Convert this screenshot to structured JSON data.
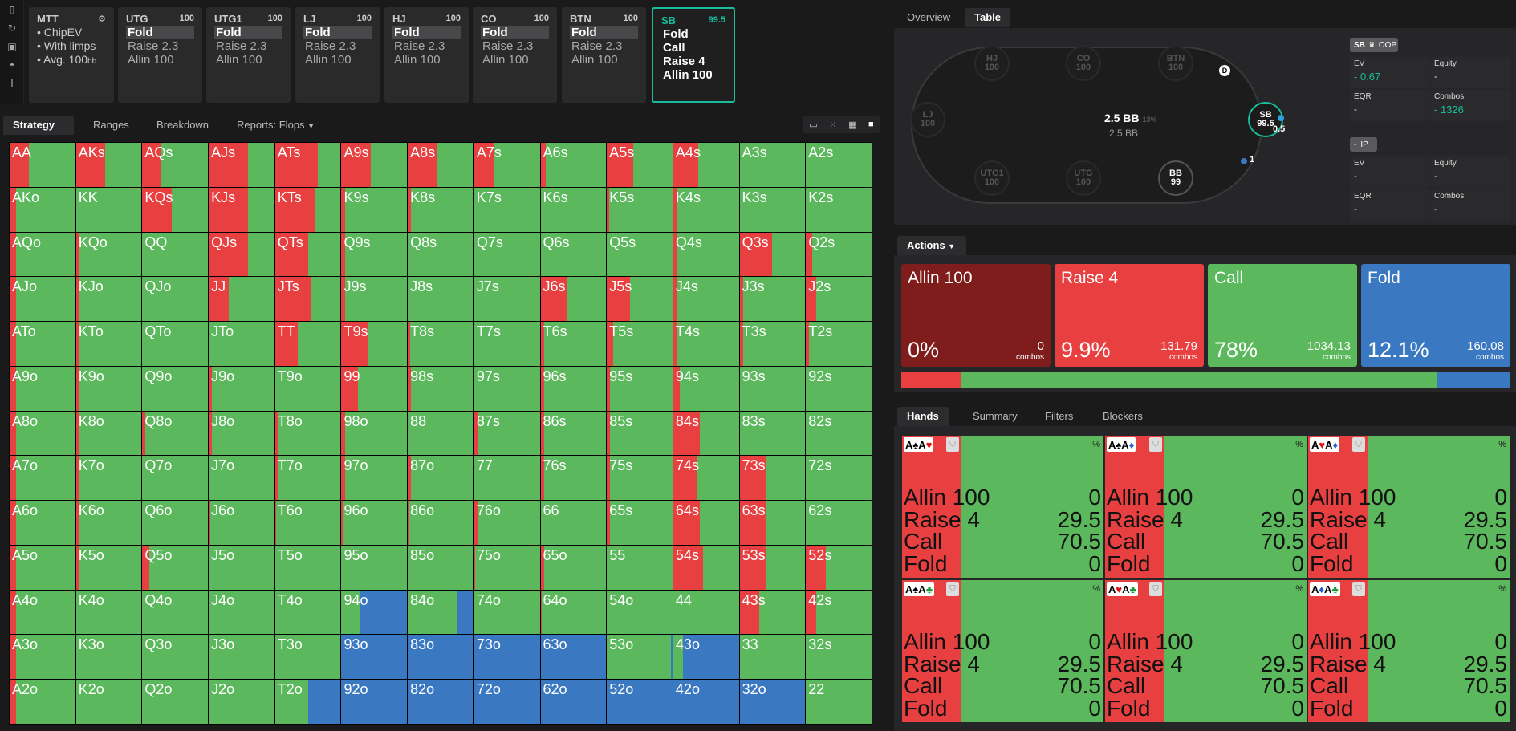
{
  "toolbar_icons": [
    "bookmark-icon",
    "refresh-icon",
    "save-icon",
    "gamepad-icon",
    "text-cursor-icon"
  ],
  "mtt": {
    "title": "MTT",
    "settings_icon": "gear-icon",
    "items": [
      "ChipEV",
      "With limps",
      "Avg. 100"
    ],
    "unit": "bb"
  },
  "positions": [
    {
      "name": "UTG",
      "stack": "100",
      "actions": [
        "Fold",
        "Raise 2.3",
        "Allin 100"
      ],
      "selected": 0
    },
    {
      "name": "UTG1",
      "stack": "100",
      "actions": [
        "Fold",
        "Raise 2.3",
        "Allin 100"
      ],
      "selected": 0
    },
    {
      "name": "LJ",
      "stack": "100",
      "actions": [
        "Fold",
        "Raise 2.3",
        "Allin 100"
      ],
      "selected": 0
    },
    {
      "name": "HJ",
      "stack": "100",
      "actions": [
        "Fold",
        "Raise 2.3",
        "Allin 100"
      ],
      "selected": 0
    },
    {
      "name": "CO",
      "stack": "100",
      "actions": [
        "Fold",
        "Raise 2.3",
        "Allin 100"
      ],
      "selected": 0
    },
    {
      "name": "BTN",
      "stack": "100",
      "actions": [
        "Fold",
        "Raise 2.3",
        "Allin 100"
      ],
      "selected": 0
    },
    {
      "name": "SB",
      "stack": "99.5",
      "actions": [
        "Fold",
        "Call",
        "Raise 4",
        "Allin 100"
      ],
      "selected": -1
    }
  ],
  "main_tabs": [
    "Strategy",
    "Ranges",
    "Breakdown",
    "Reports: Flops"
  ],
  "colors": {
    "raise": "#e84040",
    "call": "#5cb85c",
    "fold": "#3b78c2",
    "allin": "#7f1d1d",
    "accent": "#1abc9c"
  },
  "grid": [
    [
      "AA",
      "AKs",
      "AQs",
      "AJs",
      "ATs",
      "A9s",
      "A8s",
      "A7s",
      "A6s",
      "A5s",
      "A4s",
      "A3s",
      "A2s"
    ],
    [
      "AKo",
      "KK",
      "KQs",
      "KJs",
      "KTs",
      "K9s",
      "K8s",
      "K7s",
      "K6s",
      "K5s",
      "K4s",
      "K3s",
      "K2s"
    ],
    [
      "AQo",
      "KQo",
      "QQ",
      "QJs",
      "QTs",
      "Q9s",
      "Q8s",
      "Q7s",
      "Q6s",
      "Q5s",
      "Q4s",
      "Q3s",
      "Q2s"
    ],
    [
      "AJo",
      "KJo",
      "QJo",
      "JJ",
      "JTs",
      "J9s",
      "J8s",
      "J7s",
      "J6s",
      "J5s",
      "J4s",
      "J3s",
      "J2s"
    ],
    [
      "ATo",
      "KTo",
      "QTo",
      "JTo",
      "TT",
      "T9s",
      "T8s",
      "T7s",
      "T6s",
      "T5s",
      "T4s",
      "T3s",
      "T2s"
    ],
    [
      "A9o",
      "K9o",
      "Q9o",
      "J9o",
      "T9o",
      "99",
      "98s",
      "97s",
      "96s",
      "95s",
      "94s",
      "93s",
      "92s"
    ],
    [
      "A8o",
      "K8o",
      "Q8o",
      "J8o",
      "T8o",
      "98o",
      "88",
      "87s",
      "86s",
      "85s",
      "84s",
      "83s",
      "82s"
    ],
    [
      "A7o",
      "K7o",
      "Q7o",
      "J7o",
      "T7o",
      "97o",
      "87o",
      "77",
      "76s",
      "75s",
      "74s",
      "73s",
      "72s"
    ],
    [
      "A6o",
      "K6o",
      "Q6o",
      "J6o",
      "T6o",
      "96o",
      "86o",
      "76o",
      "66",
      "65s",
      "64s",
      "63s",
      "62s"
    ],
    [
      "A5o",
      "K5o",
      "Q5o",
      "J5o",
      "T5o",
      "95o",
      "85o",
      "75o",
      "65o",
      "55",
      "54s",
      "53s",
      "52s"
    ],
    [
      "A4o",
      "K4o",
      "Q4o",
      "J4o",
      "T4o",
      "94o",
      "84o",
      "74o",
      "64o",
      "54o",
      "44",
      "43s",
      "42s"
    ],
    [
      "A3o",
      "K3o",
      "Q3o",
      "J3o",
      "T3o",
      "93o",
      "83o",
      "73o",
      "63o",
      "53o",
      "43o",
      "33",
      "32s"
    ],
    [
      "A2o",
      "K2o",
      "Q2o",
      "J2o",
      "T2o",
      "92o",
      "82o",
      "72o",
      "62o",
      "52o",
      "42o",
      "32o",
      "22"
    ]
  ],
  "grid_strategy": {
    "AA": [
      0.295,
      0
    ],
    "AKs": [
      0.45,
      0
    ],
    "AQs": [
      0.29,
      0
    ],
    "AJs": [
      0.6,
      0
    ],
    "ATs": [
      0.65,
      0
    ],
    "A9s": [
      0.45,
      0
    ],
    "A8s": [
      0.45,
      0
    ],
    "A7s": [
      0.3,
      0
    ],
    "A6s": [
      0.08,
      0
    ],
    "A5s": [
      0.4,
      0
    ],
    "A4s": [
      0.38,
      0
    ],
    "AKo": [
      0.1,
      0
    ],
    "KQs": [
      0.45,
      0
    ],
    "KJs": [
      0.6,
      0
    ],
    "KTs": [
      0.6,
      0
    ],
    "K9s": [
      0.05,
      0
    ],
    "K8s": [
      0.05,
      0
    ],
    "K5s": [
      0.03,
      0
    ],
    "K4s": [
      0.05,
      0
    ],
    "AQo": [
      0.1,
      0
    ],
    "KQo": [
      0.05,
      0
    ],
    "QJs": [
      0.6,
      0
    ],
    "QTs": [
      0.5,
      0
    ],
    "Q9s": [
      0.05,
      0
    ],
    "Q4s": [
      0.05,
      0
    ],
    "Q3s": [
      0.5,
      0
    ],
    "Q2s": [
      0.1,
      0
    ],
    "AJo": [
      0.1,
      0
    ],
    "KJo": [
      0.05,
      0
    ],
    "JJ": [
      0.3,
      0
    ],
    "JTs": [
      0.55,
      0
    ],
    "J9s": [
      0.05,
      0
    ],
    "J6s": [
      0.4,
      0
    ],
    "J5s": [
      0.35,
      0
    ],
    "J4s": [
      0.05,
      0
    ],
    "J3s": [
      0.05,
      0
    ],
    "J2s": [
      0.15,
      0
    ],
    "ATo": [
      0.1,
      0
    ],
    "KTo": [
      0.05,
      0
    ],
    "TT": [
      0.35,
      0
    ],
    "T9s": [
      0.4,
      0
    ],
    "T8s": [
      0.03,
      0
    ],
    "T6s": [
      0.05,
      0
    ],
    "T5s": [
      0.1,
      0
    ],
    "T4s": [
      0.05,
      0
    ],
    "T3s": [
      0.05,
      0
    ],
    "T2s": [
      0.05,
      0
    ],
    "A9o": [
      0.1,
      0
    ],
    "K9o": [
      0.05,
      0
    ],
    "J9o": [
      0.05,
      0
    ],
    "99": [
      0.25,
      0
    ],
    "98s": [
      0.05,
      0
    ],
    "96s": [
      0.05,
      0
    ],
    "95s": [
      0.05,
      0
    ],
    "94s": [
      0.1,
      0
    ],
    "A8o": [
      0.1,
      0
    ],
    "K8o": [
      0.05,
      0
    ],
    "Q8o": [
      0.05,
      0
    ],
    "J8o": [
      0.05,
      0
    ],
    "T8o": [
      0.05,
      0
    ],
    "98o": [
      0.05,
      0
    ],
    "87s": [
      0.05,
      0
    ],
    "86s": [
      0.05,
      0
    ],
    "85s": [
      0.05,
      0
    ],
    "84s": [
      0.4,
      0
    ],
    "A7o": [
      0.1,
      0
    ],
    "K7o": [
      0.05,
      0
    ],
    "T7o": [
      0.05,
      0
    ],
    "97o": [
      0.05,
      0
    ],
    "87o": [
      0.05,
      0
    ],
    "76s": [
      0.05,
      0
    ],
    "75s": [
      0.05,
      0
    ],
    "74s": [
      0.35,
      0
    ],
    "73s": [
      0.4,
      0
    ],
    "A6o": [
      0.1,
      0
    ],
    "K6o": [
      0.05,
      0
    ],
    "J6o": [
      0.02,
      0
    ],
    "T6o": [
      0.02,
      0
    ],
    "96o": [
      0.02,
      0
    ],
    "86o": [
      0.02,
      0
    ],
    "76o": [
      0.05,
      0
    ],
    "65s": [
      0.05,
      0
    ],
    "64s": [
      0.4,
      0
    ],
    "63s": [
      0.4,
      0
    ],
    "A5o": [
      0.1,
      0
    ],
    "K5o": [
      0.05,
      0
    ],
    "Q5o": [
      0.1,
      0
    ],
    "75o": [
      0.02,
      0
    ],
    "65o": [
      0.05,
      0
    ],
    "54s": [
      0.45,
      0
    ],
    "53s": [
      0.4,
      0
    ],
    "52s": [
      0.3,
      0
    ],
    "A4o": [
      0.1,
      0
    ],
    "94o": [
      0,
      0.72
    ],
    "84o": [
      0,
      0.25
    ],
    "64o": [
      0.02,
      0
    ],
    "43s": [
      0.3,
      0
    ],
    "42s": [
      0.15,
      0
    ],
    "A3o": [
      0.1,
      0
    ],
    "93o": [
      0,
      1
    ],
    "83o": [
      0,
      1
    ],
    "73o": [
      0,
      1
    ],
    "63o": [
      0,
      1
    ],
    "53o": [
      0,
      0.02
    ],
    "43o": [
      0,
      0.85
    ],
    "A2o": [
      0.1,
      0
    ],
    "T2o": [
      0,
      0.5
    ],
    "92o": [
      0,
      1
    ],
    "82o": [
      0,
      1
    ],
    "72o": [
      0,
      1
    ],
    "62o": [
      0,
      1
    ],
    "52o": [
      0,
      1
    ],
    "42o": [
      0,
      1
    ],
    "32o": [
      0,
      1
    ]
  },
  "right_tabs": [
    "Overview",
    "Table"
  ],
  "table": {
    "pot": "2.5 BB",
    "pot_pct": "13%",
    "pot_sub": "2.5 BB",
    "dealer": "D",
    "seats": [
      {
        "name": "HJ",
        "stack": "100"
      },
      {
        "name": "CO",
        "stack": "100"
      },
      {
        "name": "BTN",
        "stack": "100"
      },
      {
        "name": "LJ",
        "stack": "100"
      },
      {
        "name": "SB",
        "stack": "99.5"
      },
      {
        "name": "UTG1",
        "stack": "100"
      },
      {
        "name": "UTG",
        "stack": "100"
      },
      {
        "name": "BB",
        "stack": "99"
      }
    ],
    "sb_bet": "0.5",
    "bb_bet": "1"
  },
  "stats": {
    "oop": {
      "player": "SB",
      "crown_icon": "crown-icon",
      "tag": "OOP",
      "ev_label": "EV",
      "ev": "- 0.67",
      "equity_label": "Equity",
      "equity": "-",
      "eqr_label": "EQR",
      "eqr": "-",
      "combos_label": "Combos",
      "combos": "- 1326"
    },
    "ip": {
      "player": "-",
      "tag": "IP",
      "ev_label": "EV",
      "ev": "-",
      "equity_label": "Equity",
      "equity": "-",
      "eqr_label": "EQR",
      "eqr": "-",
      "combos_label": "Combos",
      "combos": "-"
    }
  },
  "actions_dropdown": "Actions",
  "action_cards": [
    {
      "name": "Allin 100",
      "pct": "0%",
      "combos": "0",
      "combos_label": "combos"
    },
    {
      "name": "Raise 4",
      "pct": "9.9%",
      "combos": "131.79",
      "combos_label": "combos"
    },
    {
      "name": "Call",
      "pct": "78%",
      "combos": "1034.13",
      "combos_label": "combos"
    },
    {
      "name": "Fold",
      "pct": "12.1%",
      "combos": "160.08",
      "combos_label": "combos"
    }
  ],
  "action_bar": {
    "allin": 0,
    "raise": 9.9,
    "call": 78,
    "fold": 12.1
  },
  "bottom_tabs": [
    "Hands",
    "Summary",
    "Filters",
    "Blockers"
  ],
  "hands": [
    {
      "c1": "A",
      "s1": "♠",
      "c2": "A",
      "s2": "♥"
    },
    {
      "c1": "A",
      "s1": "♠",
      "c2": "A",
      "s2": "♦"
    },
    {
      "c1": "A",
      "s1": "♥",
      "c2": "A",
      "s2": "♦"
    },
    {
      "c1": "A",
      "s1": "♠",
      "c2": "A",
      "s2": "♣"
    },
    {
      "c1": "A",
      "s1": "♥",
      "c2": "A",
      "s2": "♣"
    },
    {
      "c1": "A",
      "s1": "♦",
      "c2": "A",
      "s2": "♣"
    }
  ],
  "hand_rows": [
    {
      "label": "Allin 100",
      "val": "0"
    },
    {
      "label": "Raise 4",
      "val": "29.5"
    },
    {
      "label": "Call",
      "val": "70.5"
    },
    {
      "label": "Fold",
      "val": "0"
    }
  ],
  "hand_pct_label": "%"
}
